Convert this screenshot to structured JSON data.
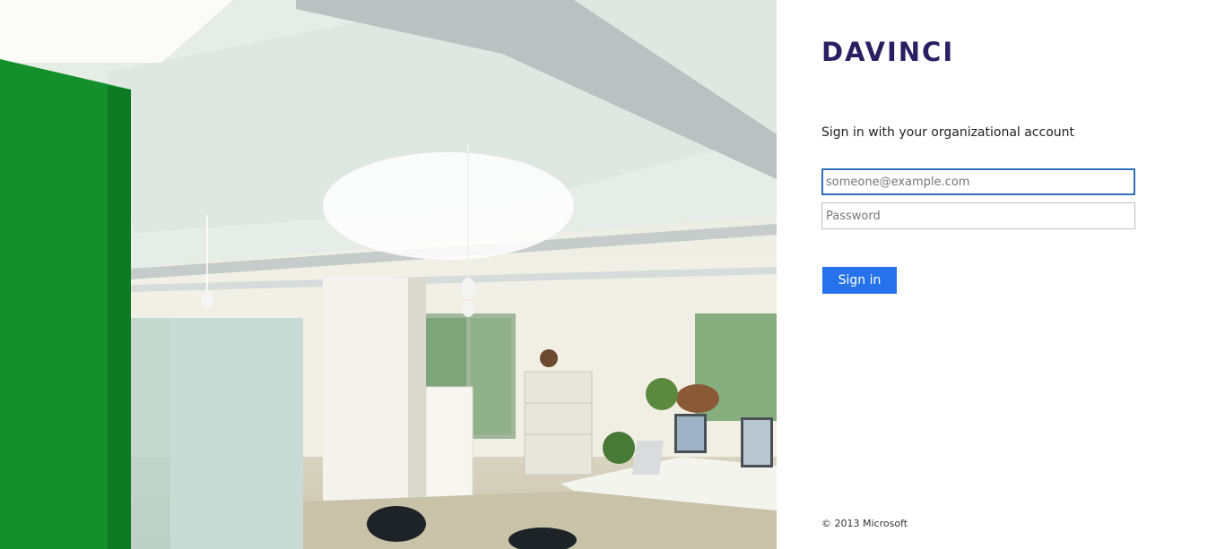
{
  "illustration": {
    "alt": "Office interior photo"
  },
  "brand": {
    "logo_text": "DAVINCI",
    "color": "#2b1f63"
  },
  "signin": {
    "intro": "Sign in with your organizational account",
    "email": {
      "value": "",
      "placeholder": "someone@example.com"
    },
    "password": {
      "value": "",
      "placeholder": "Password"
    },
    "submit_label": "Sign in",
    "accent": "#2672ec"
  },
  "footer": {
    "copyright": "© 2013 Microsoft"
  }
}
